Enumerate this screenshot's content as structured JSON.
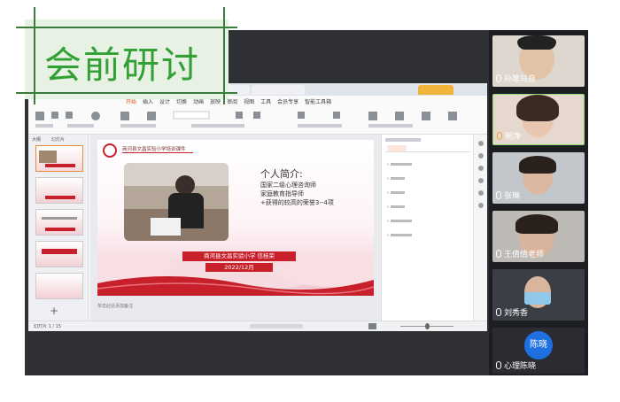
{
  "heading": {
    "text": "会前研讨"
  },
  "wps": {
    "tabs": [
      "",
      "",
      "",
      "",
      ""
    ],
    "menu": [
      "开始",
      "插入",
      "设计",
      "切换",
      "动画",
      "放映",
      "审阅",
      "视图",
      "工具",
      "会员专享",
      "智能工具箱"
    ],
    "thumb_tabs": [
      "大纲",
      "幻灯片"
    ],
    "slide_count": "幻灯片 1 / 15",
    "notes_placeholder": "单击此处添加备注",
    "right_panel_title": "",
    "right_panel_items": [
      "",
      "",
      "",
      "",
      "",
      ""
    ]
  },
  "slide": {
    "school_header": "商河县文昌实验小学培训课件",
    "intro_title": "个人简介:",
    "intro_lines": [
      "国家二级心理咨询师",
      "家庭教育指导师",
      "+获得的较高的荣誉3--4项"
    ],
    "banner_text": "商河县文昌实验小学    信桂荣",
    "date_text": "2022/12月"
  },
  "participants": [
    {
      "name": "孙笔马良",
      "bg": "#c8c2ba"
    },
    {
      "name": "明净",
      "bg": "#d8c7bd"
    },
    {
      "name": "张琳",
      "bg": "#bfc4c8"
    },
    {
      "name": "王倩倩老师",
      "bg": "#b9b6b2"
    },
    {
      "name": "刘秀香",
      "bg": "#3b3f45"
    },
    {
      "name": "心理陈晓",
      "bg": "#2a2c31",
      "avatar_text": "陈晓",
      "avatar_color": "#1e6fe0"
    }
  ],
  "colors": {
    "accent_red": "#c8202a",
    "heading_green": "#33a036"
  }
}
